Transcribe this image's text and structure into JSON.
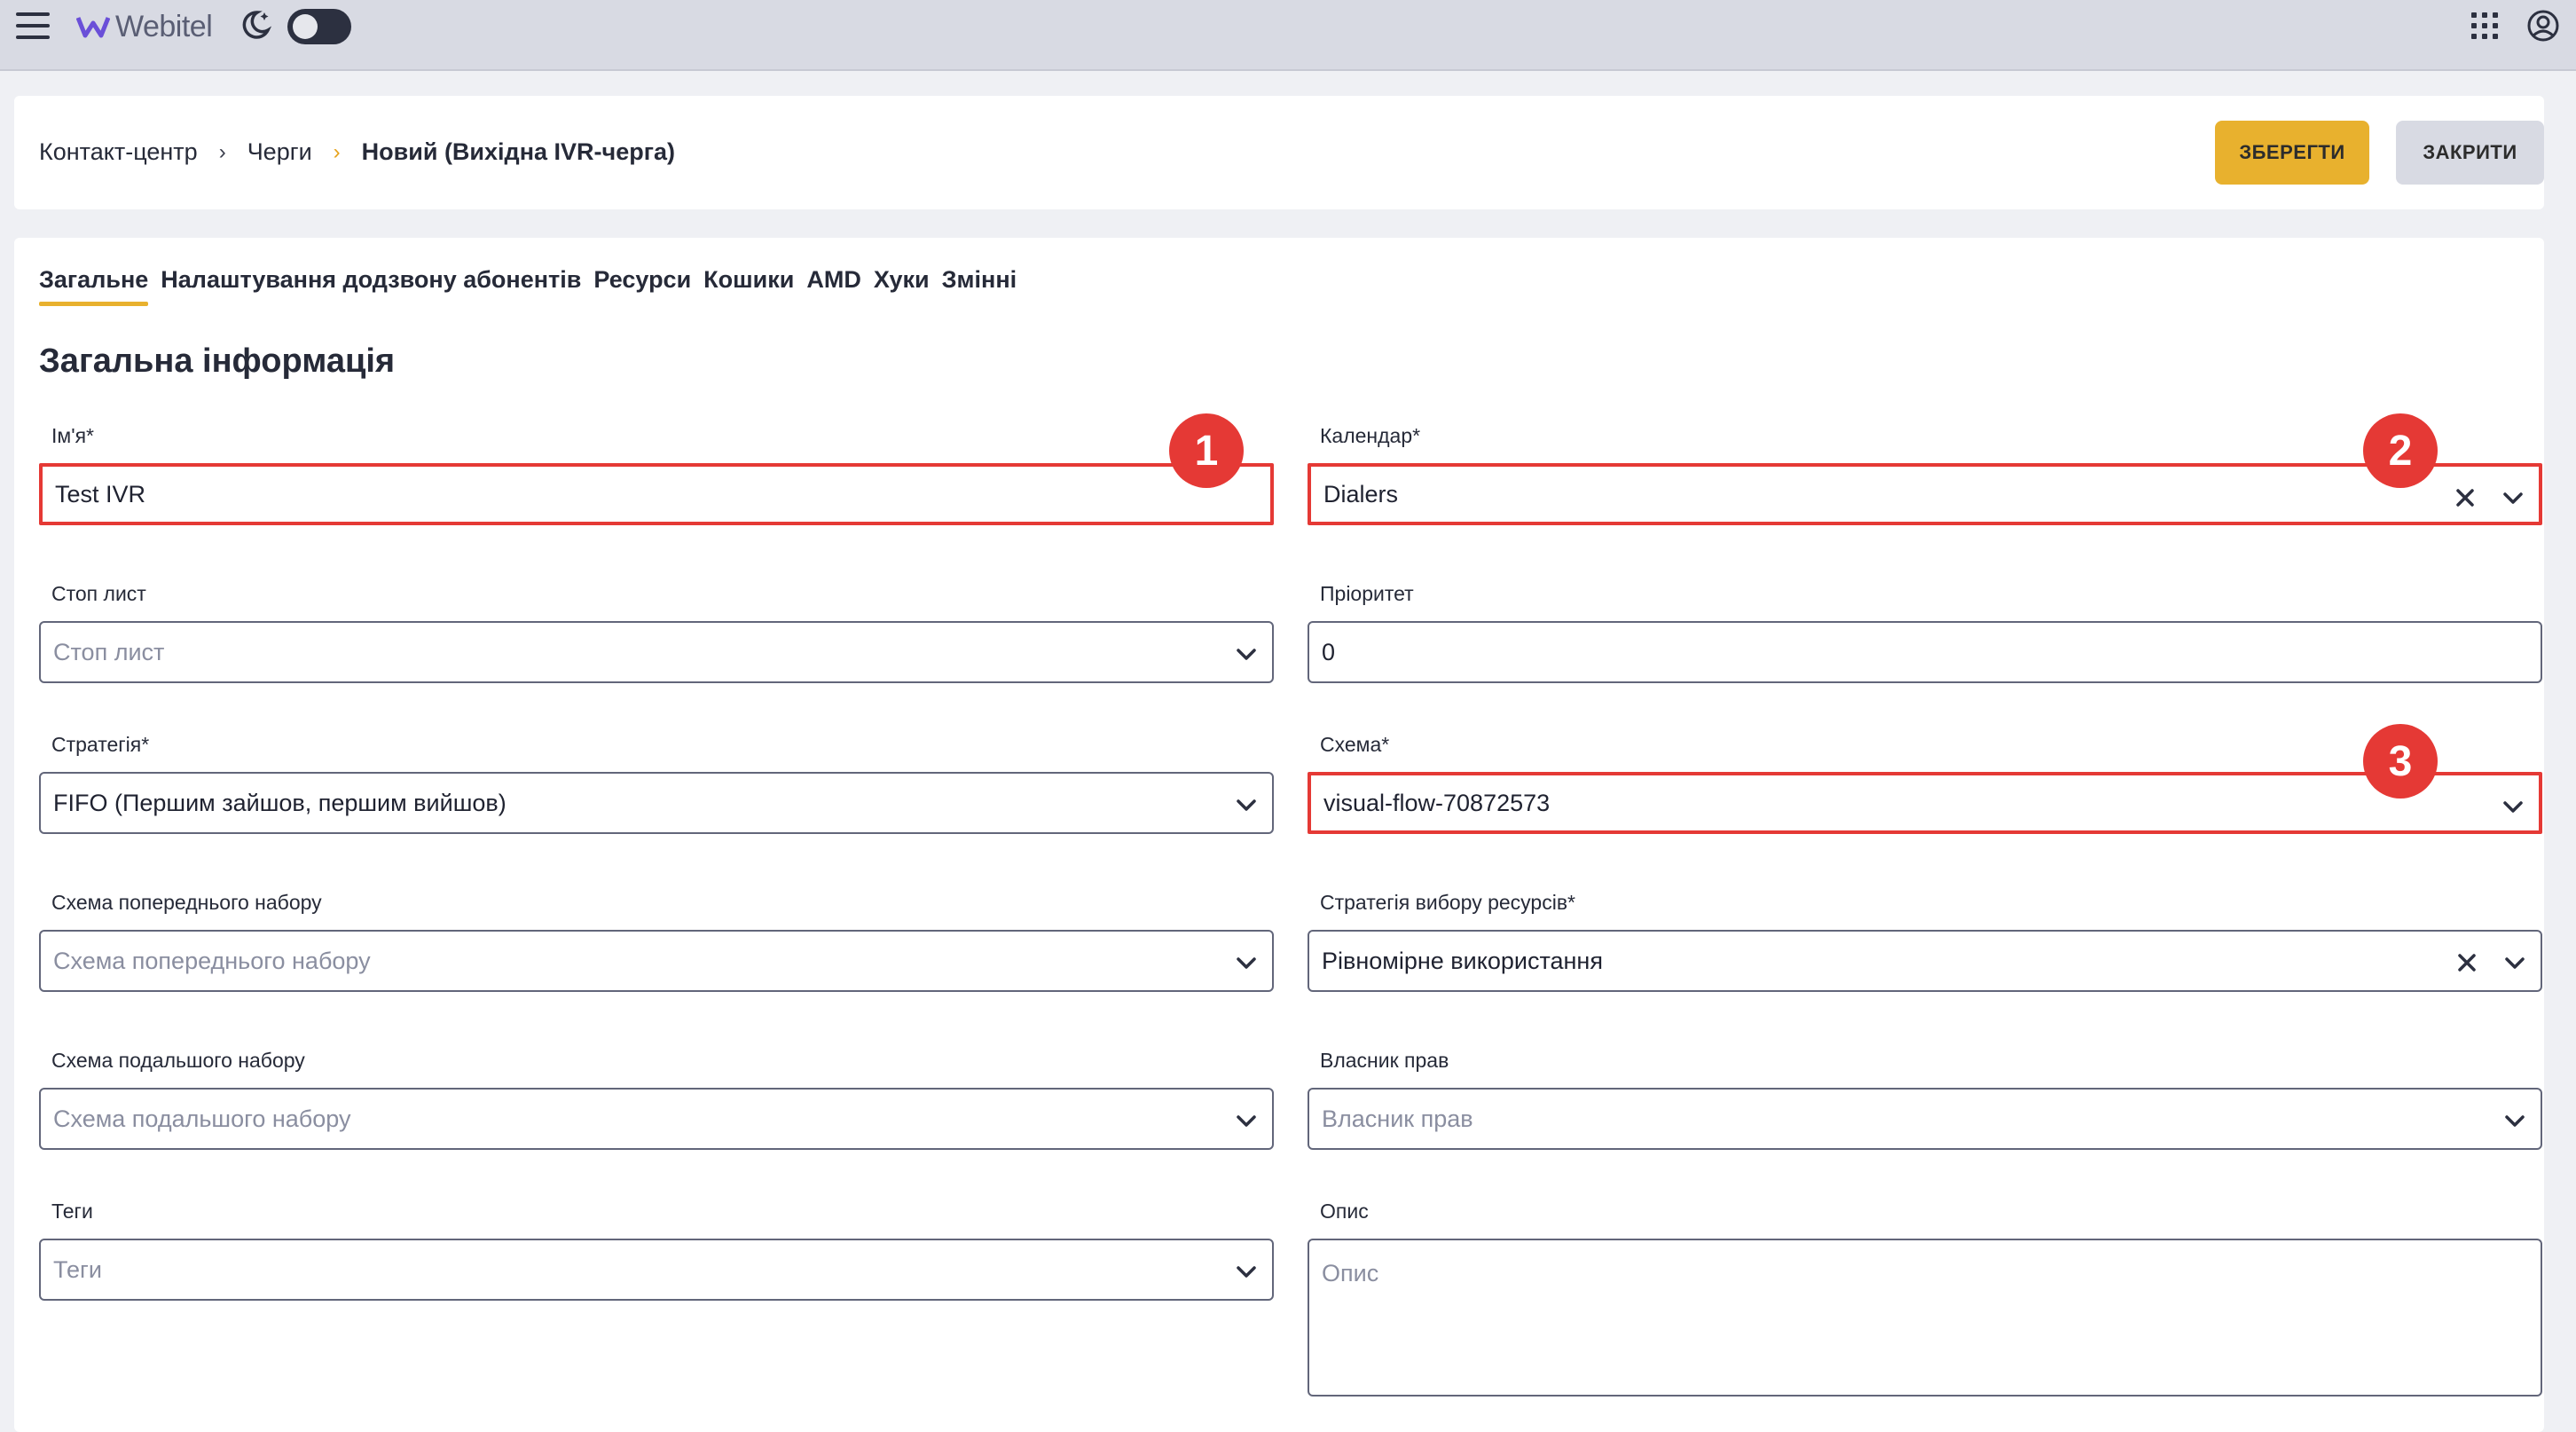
{
  "app": {
    "logo_text": "Webitel"
  },
  "breadcrumb": {
    "item1": "Контакт-центр",
    "item2": "Черги",
    "current": "Новий (Вихідна IVR-черга)"
  },
  "actions": {
    "save": "ЗБЕРЕГТИ",
    "close": "ЗАКРИТИ"
  },
  "tabs": [
    "Загальне",
    "Налаштування додзвону абонентів",
    "Ресурси",
    "Кошики",
    "AMD",
    "Хуки",
    "Змінні"
  ],
  "section_title": "Загальна інформація",
  "fields": {
    "name": {
      "label": "Ім'я*",
      "value": "Test IVR"
    },
    "calendar": {
      "label": "Календар*",
      "value": "Dialers"
    },
    "stop_list": {
      "label": "Стоп лист",
      "placeholder": "Стоп лист"
    },
    "priority": {
      "label": "Пріоритет",
      "value": "0"
    },
    "strategy": {
      "label": "Стратегія*",
      "value": "FIFO (Першим зайшов, першим вийшов)"
    },
    "schema": {
      "label": "Схема*",
      "value": "visual-flow-70872573"
    },
    "pre_schema": {
      "label": "Схема попереднього набору",
      "placeholder": "Схема попереднього набору"
    },
    "resource_strategy": {
      "label": "Стратегія вибору ресурсів*",
      "value": "Рівномірне використання"
    },
    "post_schema": {
      "label": "Схема подальшого набору",
      "placeholder": "Схема подальшого набору"
    },
    "owner": {
      "label": "Власник прав",
      "placeholder": "Власник прав"
    },
    "tags": {
      "label": "Теги",
      "placeholder": "Теги"
    },
    "description": {
      "label": "Опис",
      "placeholder": "Опис"
    }
  },
  "annotations": [
    "1",
    "2",
    "3"
  ],
  "colors": {
    "accent": "#e8b12e",
    "highlight": "#e53935",
    "topbar": "#d8dae3"
  }
}
